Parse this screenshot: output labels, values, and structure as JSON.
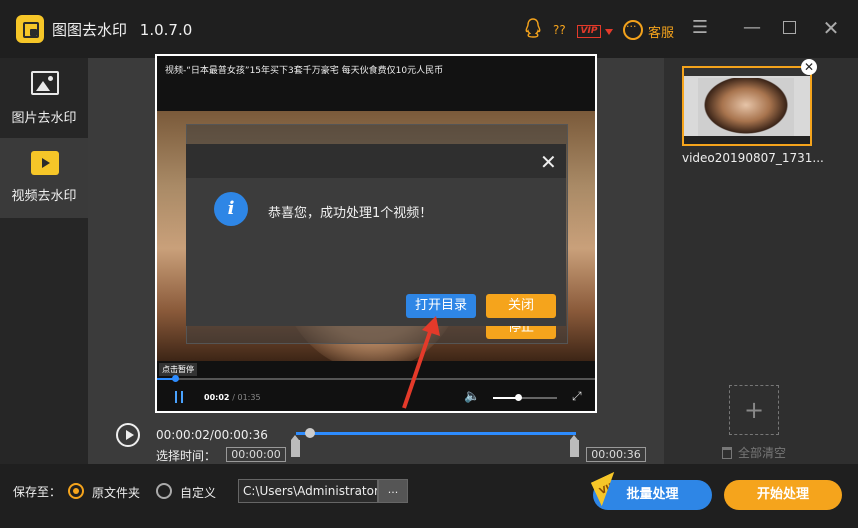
{
  "app": {
    "title": "图图去水印",
    "version": "1.0.7.0",
    "question_mark": "??",
    "vip_badge": "VIP",
    "service_label": "客服"
  },
  "sidebar": {
    "items": [
      {
        "label": "图片去水印",
        "icon": "image-icon",
        "active": false
      },
      {
        "label": "视频去水印",
        "icon": "video-icon",
        "active": true
      }
    ]
  },
  "video": {
    "caption": "视频-“日本最普女孩”15年买下3套千万豪宅 每天伙食费仅10元人民币",
    "pause_hint": "点击暂停",
    "current_time": "00:02",
    "total_time": "/ 01:35"
  },
  "dialog": {
    "message": "恭喜您，成功处理1个视频！",
    "open_folder_label": "打开目录",
    "close_label": "关闭",
    "info_glyph": "i"
  },
  "behind_button_label": "停止",
  "timeline": {
    "readout": "00:00:02/00:00:36",
    "select_label": "选择时间：",
    "start_time": "00:00:00",
    "end_time": "00:00:36"
  },
  "right_panel": {
    "thumbnail_name": "video20190807_1731...",
    "clear_all_label": "全部清空",
    "add_symbol": "+"
  },
  "bottom": {
    "save_to_label": "保存至：",
    "option_original": "原文件夹",
    "option_custom": "自定义",
    "path_value": "C:\\Users\\Administrator",
    "browse_label": "...",
    "batch_label": "批量处理",
    "batch_vip": "VIP",
    "start_label": "开始处理"
  },
  "colors": {
    "accent_orange": "#f5a41c",
    "accent_blue": "#2e86e6",
    "vip_red": "#e43a2a"
  }
}
